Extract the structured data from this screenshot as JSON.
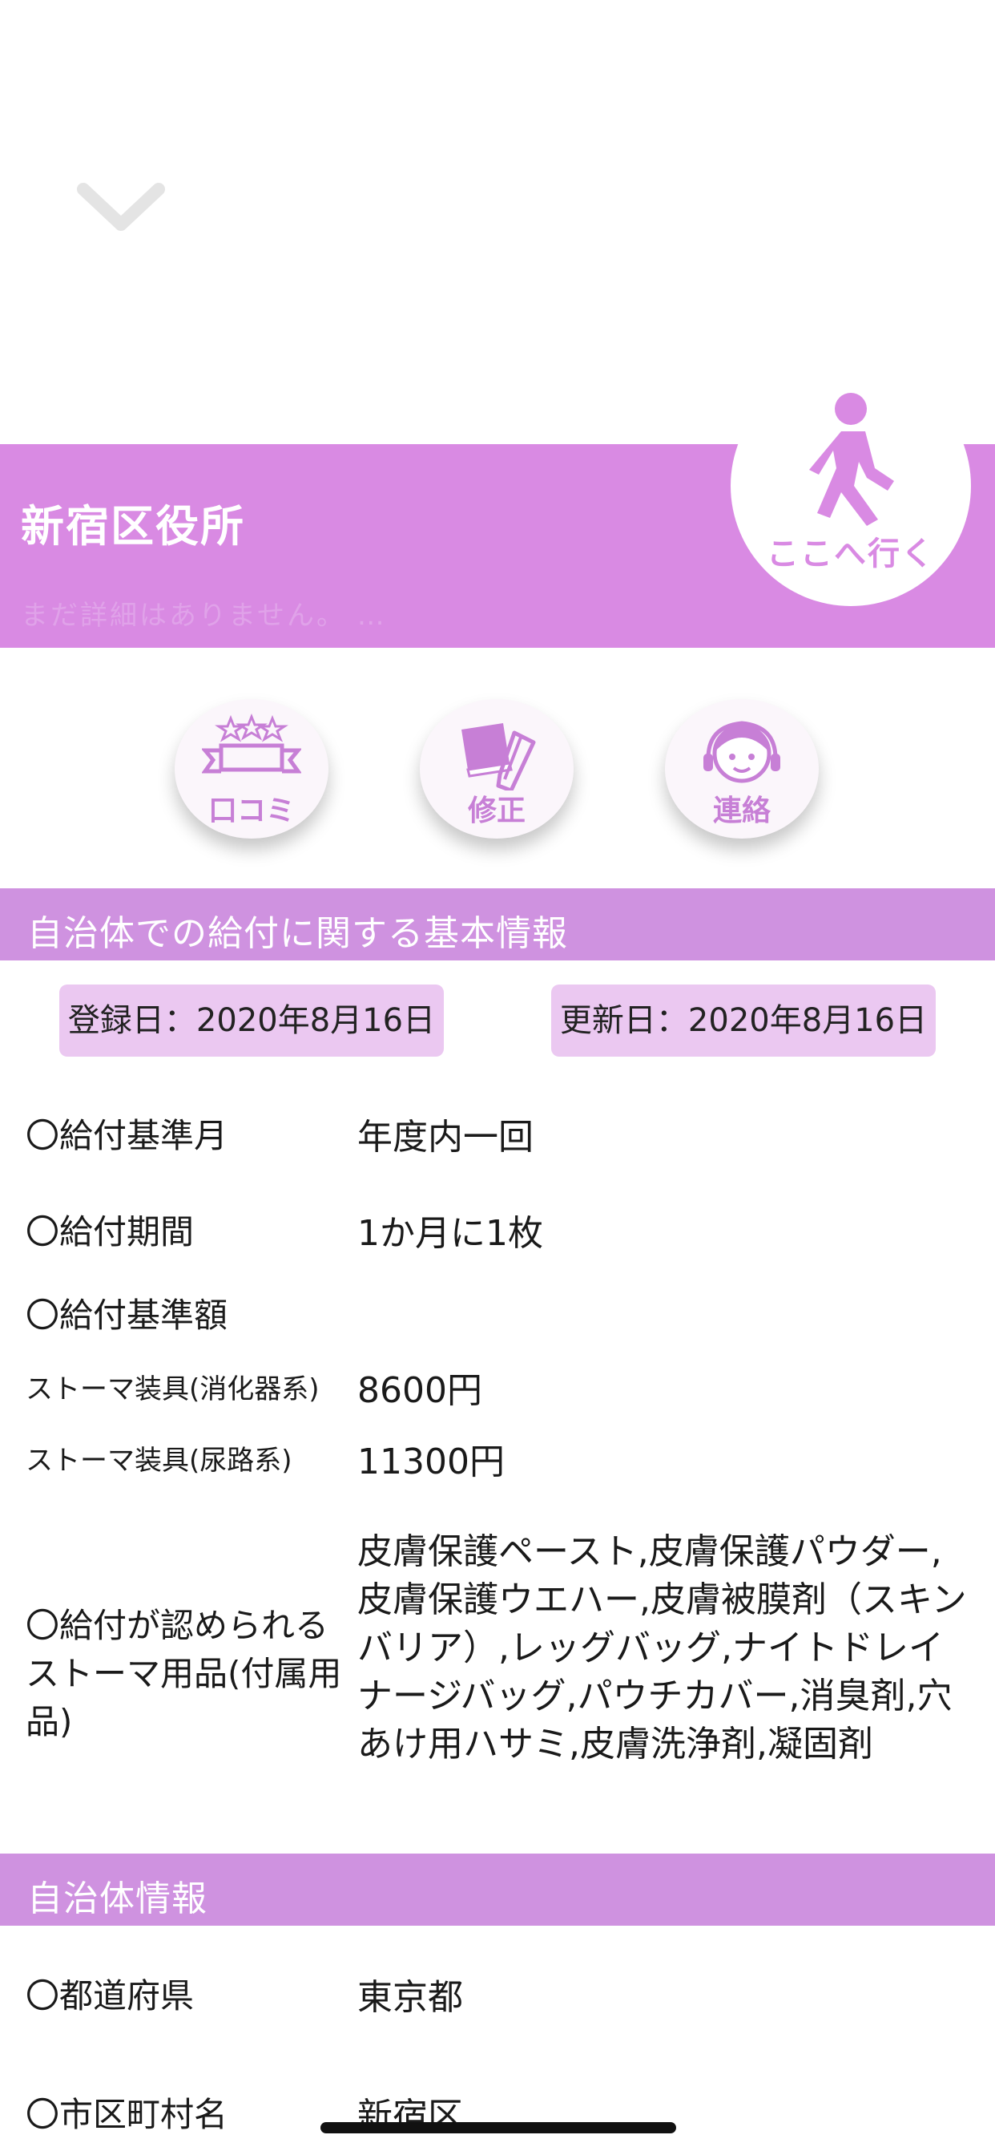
{
  "header": {
    "place_name": "新宿区役所",
    "subtitle": "まだ詳細はありません。 …",
    "go_here_label": "ここへ行く"
  },
  "actions": [
    {
      "label": "口コミ",
      "icon": "review-stars-icon"
    },
    {
      "label": "修正",
      "icon": "edit-pencil-icon"
    },
    {
      "label": "連絡",
      "icon": "contact-operator-icon"
    }
  ],
  "basic_info": {
    "title": "自治体での給付に関する基本情報",
    "registered": "登録日：2020年8月16日",
    "updated": "更新日：2020年8月16日",
    "rows": [
      {
        "label": "〇給付基準月",
        "value": "年度内一回"
      },
      {
        "label": "〇給付期間",
        "value": "1か月に1枚"
      },
      {
        "label": "〇給付基準額",
        "value": ""
      },
      {
        "label": "ストーマ装具(消化器系)",
        "value": "8600円"
      },
      {
        "label": "ストーマ装具(尿路系)",
        "value": "11300円"
      }
    ],
    "supplies_label": "〇給付が認められるストーマ用品(付属用品)",
    "supplies_value": "皮膚保護ペースト,皮膚保護パウダー,皮膚保護ウエハー,皮膚被膜剤（スキンバリア）,レッグバッグ,ナイトドレイナージバッグ,パウチカバー,消臭剤,穴あけ用ハサミ,皮膚洗浄剤,凝固剤"
  },
  "municipality": {
    "title": "自治体情報",
    "rows": [
      {
        "label": "〇都道府県",
        "value": "東京都"
      },
      {
        "label": "〇市区町村名",
        "value": "新宿区"
      }
    ]
  },
  "colors": {
    "accent": "#d98ae3",
    "section": "#cf92e0",
    "chip": "#ebc8f1"
  }
}
